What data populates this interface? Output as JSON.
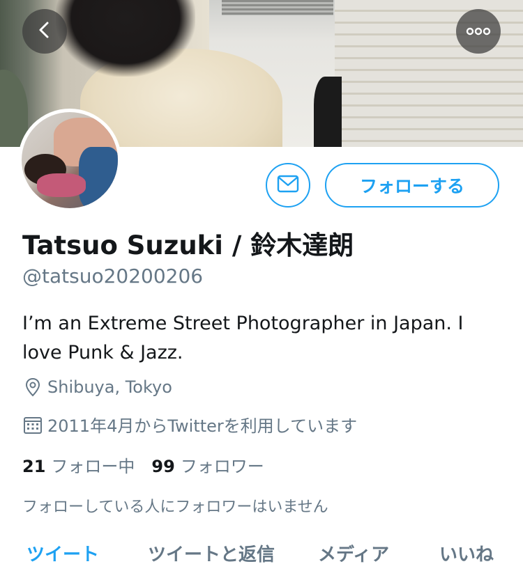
{
  "header": {
    "back_icon": "chevron-left-icon",
    "more_icon": "more-horizontal-icon"
  },
  "actions": {
    "message_icon": "mail-icon",
    "follow_label": "フォローする"
  },
  "profile": {
    "display_name": "Tatsuo Suzuki / 鈴木達朗",
    "handle": "@tatsuo20200206",
    "bio": "I’m an Extreme Street Photographer in Japan. I love Punk & Jazz.",
    "location": "Shibuya, Tokyo",
    "location_icon": "location-pin-icon",
    "joined": "2011年4月からTwitterを利用しています",
    "joined_icon": "calendar-icon"
  },
  "stats": {
    "following_count": "21",
    "following_label": "フォロー中",
    "followers_count": "99",
    "followers_label": "フォロワー"
  },
  "followed_by_text": "フォローしている人にフォロワーはいません",
  "tabs": [
    {
      "label": "ツイート",
      "active": true
    },
    {
      "label": "ツイートと返信",
      "active": false
    },
    {
      "label": "メディア",
      "active": false
    },
    {
      "label": "いいね",
      "active": false
    }
  ],
  "colors": {
    "accent": "#1da1f2",
    "text_primary": "#14171a",
    "text_secondary": "#657786"
  }
}
